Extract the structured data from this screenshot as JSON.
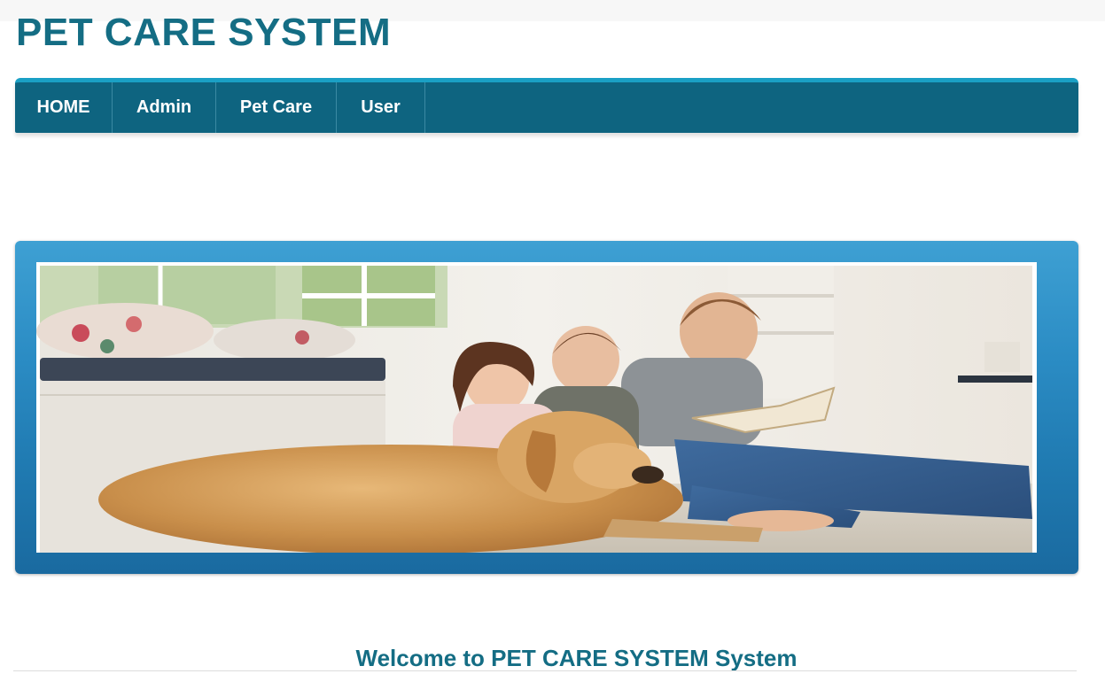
{
  "header": {
    "title": "PET CARE SYSTEM"
  },
  "nav": {
    "items": [
      {
        "label": "HOME"
      },
      {
        "label": "Admin"
      },
      {
        "label": "Pet Care"
      },
      {
        "label": "User"
      }
    ]
  },
  "banner": {
    "image_icon": "family-with-dog-photo"
  },
  "main": {
    "welcome": "Welcome to PET CARE SYSTEM System"
  },
  "colors": {
    "brand_text": "#146d84",
    "nav_bg": "#0e6480",
    "nav_accent": "#1aa0c5",
    "banner_blue": "#2b8cc4"
  }
}
